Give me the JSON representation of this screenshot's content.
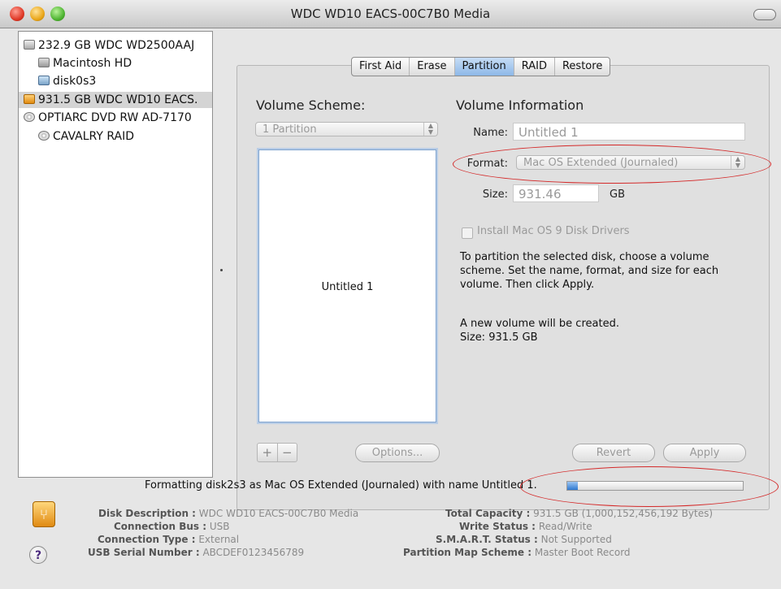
{
  "window": {
    "title": "WDC WD10 EACS-00C7B0 Media"
  },
  "sidebar": {
    "items": [
      {
        "label": "232.9 GB WDC WD2500AAJ",
        "icon": "hard-disk-icon"
      },
      {
        "label": "Macintosh HD",
        "icon": "volume-icon"
      },
      {
        "label": "disk0s3",
        "icon": "disk-image-icon"
      },
      {
        "label": "931.5 GB WDC WD10 EACS.",
        "icon": "external-disk-icon",
        "selected": true
      },
      {
        "label": "OPTIARC DVD RW AD-7170",
        "icon": "optical-drive-icon"
      },
      {
        "label": "CAVALRY RAID",
        "icon": "disc-icon"
      }
    ]
  },
  "tabs": [
    {
      "label": "First Aid"
    },
    {
      "label": "Erase"
    },
    {
      "label": "Partition",
      "selected": true
    },
    {
      "label": "RAID"
    },
    {
      "label": "Restore"
    }
  ],
  "partition": {
    "scheme_heading": "Volume Scheme:",
    "scheme_value": "1 Partition",
    "volume_label": "Untitled 1",
    "info_heading": "Volume Information",
    "name_label": "Name:",
    "name_value": "Untitled 1",
    "format_label": "Format:",
    "format_value": "Mac OS Extended (Journaled)",
    "size_label": "Size:",
    "size_value": "931.46",
    "size_unit": "GB",
    "install_drivers_label": "Install Mac OS 9 Disk Drivers",
    "instructions": "To partition the selected disk, choose a volume scheme. Set the name, format, and size for each volume. Then click Apply.",
    "result_line1": "A new volume will be created.",
    "result_line2": "Size: 931.5 GB",
    "plus_label": "+",
    "minus_label": "−",
    "options_label": "Options...",
    "revert_label": "Revert",
    "apply_label": "Apply"
  },
  "status": {
    "text": "Formatting disk2s3 as Mac OS Extended (Journaled) with name Untitled 1.",
    "progress_percent": 6
  },
  "disk_info": {
    "left": [
      {
        "key": "Disk Description :",
        "value": "WDC WD10 EACS-00C7B0 Media"
      },
      {
        "key": "Connection Bus :",
        "value": "USB"
      },
      {
        "key": "Connection Type :",
        "value": "External"
      },
      {
        "key": "USB Serial Number :",
        "value": "ABCDEF0123456789"
      }
    ],
    "right": [
      {
        "key": "Total Capacity :",
        "value": "931.5 GB (1,000,152,456,192 Bytes)"
      },
      {
        "key": "Write Status :",
        "value": "Read/Write"
      },
      {
        "key": "S.M.A.R.T. Status :",
        "value": "Not Supported"
      },
      {
        "key": "Partition Map Scheme :",
        "value": "Master Boot Record"
      }
    ]
  },
  "help_label": "?",
  "colors": {
    "annotation": "#d42a2a",
    "selection_blue": "#8db8e8",
    "progress_blue": "#2f78d0"
  }
}
